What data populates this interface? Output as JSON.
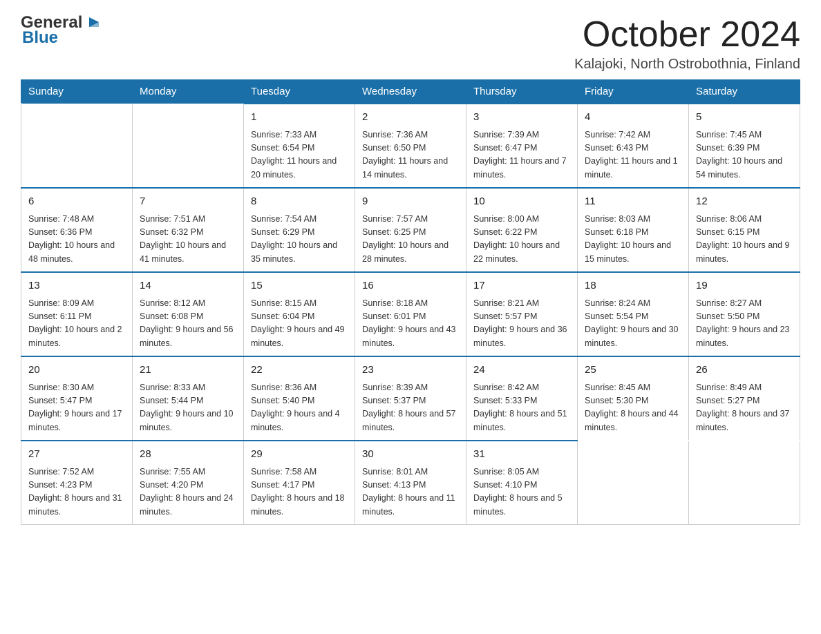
{
  "header": {
    "logo_general": "General",
    "logo_blue": "Blue",
    "month_title": "October 2024",
    "location": "Kalajoki, North Ostrobothnia, Finland"
  },
  "days_of_week": [
    "Sunday",
    "Monday",
    "Tuesday",
    "Wednesday",
    "Thursday",
    "Friday",
    "Saturday"
  ],
  "weeks": [
    [
      {
        "day": "",
        "sunrise": "",
        "sunset": "",
        "daylight": ""
      },
      {
        "day": "",
        "sunrise": "",
        "sunset": "",
        "daylight": ""
      },
      {
        "day": "1",
        "sunrise": "Sunrise: 7:33 AM",
        "sunset": "Sunset: 6:54 PM",
        "daylight": "Daylight: 11 hours and 20 minutes."
      },
      {
        "day": "2",
        "sunrise": "Sunrise: 7:36 AM",
        "sunset": "Sunset: 6:50 PM",
        "daylight": "Daylight: 11 hours and 14 minutes."
      },
      {
        "day": "3",
        "sunrise": "Sunrise: 7:39 AM",
        "sunset": "Sunset: 6:47 PM",
        "daylight": "Daylight: 11 hours and 7 minutes."
      },
      {
        "day": "4",
        "sunrise": "Sunrise: 7:42 AM",
        "sunset": "Sunset: 6:43 PM",
        "daylight": "Daylight: 11 hours and 1 minute."
      },
      {
        "day": "5",
        "sunrise": "Sunrise: 7:45 AM",
        "sunset": "Sunset: 6:39 PM",
        "daylight": "Daylight: 10 hours and 54 minutes."
      }
    ],
    [
      {
        "day": "6",
        "sunrise": "Sunrise: 7:48 AM",
        "sunset": "Sunset: 6:36 PM",
        "daylight": "Daylight: 10 hours and 48 minutes."
      },
      {
        "day": "7",
        "sunrise": "Sunrise: 7:51 AM",
        "sunset": "Sunset: 6:32 PM",
        "daylight": "Daylight: 10 hours and 41 minutes."
      },
      {
        "day": "8",
        "sunrise": "Sunrise: 7:54 AM",
        "sunset": "Sunset: 6:29 PM",
        "daylight": "Daylight: 10 hours and 35 minutes."
      },
      {
        "day": "9",
        "sunrise": "Sunrise: 7:57 AM",
        "sunset": "Sunset: 6:25 PM",
        "daylight": "Daylight: 10 hours and 28 minutes."
      },
      {
        "day": "10",
        "sunrise": "Sunrise: 8:00 AM",
        "sunset": "Sunset: 6:22 PM",
        "daylight": "Daylight: 10 hours and 22 minutes."
      },
      {
        "day": "11",
        "sunrise": "Sunrise: 8:03 AM",
        "sunset": "Sunset: 6:18 PM",
        "daylight": "Daylight: 10 hours and 15 minutes."
      },
      {
        "day": "12",
        "sunrise": "Sunrise: 8:06 AM",
        "sunset": "Sunset: 6:15 PM",
        "daylight": "Daylight: 10 hours and 9 minutes."
      }
    ],
    [
      {
        "day": "13",
        "sunrise": "Sunrise: 8:09 AM",
        "sunset": "Sunset: 6:11 PM",
        "daylight": "Daylight: 10 hours and 2 minutes."
      },
      {
        "day": "14",
        "sunrise": "Sunrise: 8:12 AM",
        "sunset": "Sunset: 6:08 PM",
        "daylight": "Daylight: 9 hours and 56 minutes."
      },
      {
        "day": "15",
        "sunrise": "Sunrise: 8:15 AM",
        "sunset": "Sunset: 6:04 PM",
        "daylight": "Daylight: 9 hours and 49 minutes."
      },
      {
        "day": "16",
        "sunrise": "Sunrise: 8:18 AM",
        "sunset": "Sunset: 6:01 PM",
        "daylight": "Daylight: 9 hours and 43 minutes."
      },
      {
        "day": "17",
        "sunrise": "Sunrise: 8:21 AM",
        "sunset": "Sunset: 5:57 PM",
        "daylight": "Daylight: 9 hours and 36 minutes."
      },
      {
        "day": "18",
        "sunrise": "Sunrise: 8:24 AM",
        "sunset": "Sunset: 5:54 PM",
        "daylight": "Daylight: 9 hours and 30 minutes."
      },
      {
        "day": "19",
        "sunrise": "Sunrise: 8:27 AM",
        "sunset": "Sunset: 5:50 PM",
        "daylight": "Daylight: 9 hours and 23 minutes."
      }
    ],
    [
      {
        "day": "20",
        "sunrise": "Sunrise: 8:30 AM",
        "sunset": "Sunset: 5:47 PM",
        "daylight": "Daylight: 9 hours and 17 minutes."
      },
      {
        "day": "21",
        "sunrise": "Sunrise: 8:33 AM",
        "sunset": "Sunset: 5:44 PM",
        "daylight": "Daylight: 9 hours and 10 minutes."
      },
      {
        "day": "22",
        "sunrise": "Sunrise: 8:36 AM",
        "sunset": "Sunset: 5:40 PM",
        "daylight": "Daylight: 9 hours and 4 minutes."
      },
      {
        "day": "23",
        "sunrise": "Sunrise: 8:39 AM",
        "sunset": "Sunset: 5:37 PM",
        "daylight": "Daylight: 8 hours and 57 minutes."
      },
      {
        "day": "24",
        "sunrise": "Sunrise: 8:42 AM",
        "sunset": "Sunset: 5:33 PM",
        "daylight": "Daylight: 8 hours and 51 minutes."
      },
      {
        "day": "25",
        "sunrise": "Sunrise: 8:45 AM",
        "sunset": "Sunset: 5:30 PM",
        "daylight": "Daylight: 8 hours and 44 minutes."
      },
      {
        "day": "26",
        "sunrise": "Sunrise: 8:49 AM",
        "sunset": "Sunset: 5:27 PM",
        "daylight": "Daylight: 8 hours and 37 minutes."
      }
    ],
    [
      {
        "day": "27",
        "sunrise": "Sunrise: 7:52 AM",
        "sunset": "Sunset: 4:23 PM",
        "daylight": "Daylight: 8 hours and 31 minutes."
      },
      {
        "day": "28",
        "sunrise": "Sunrise: 7:55 AM",
        "sunset": "Sunset: 4:20 PM",
        "daylight": "Daylight: 8 hours and 24 minutes."
      },
      {
        "day": "29",
        "sunrise": "Sunrise: 7:58 AM",
        "sunset": "Sunset: 4:17 PM",
        "daylight": "Daylight: 8 hours and 18 minutes."
      },
      {
        "day": "30",
        "sunrise": "Sunrise: 8:01 AM",
        "sunset": "Sunset: 4:13 PM",
        "daylight": "Daylight: 8 hours and 11 minutes."
      },
      {
        "day": "31",
        "sunrise": "Sunrise: 8:05 AM",
        "sunset": "Sunset: 4:10 PM",
        "daylight": "Daylight: 8 hours and 5 minutes."
      },
      {
        "day": "",
        "sunrise": "",
        "sunset": "",
        "daylight": ""
      },
      {
        "day": "",
        "sunrise": "",
        "sunset": "",
        "daylight": ""
      }
    ]
  ]
}
